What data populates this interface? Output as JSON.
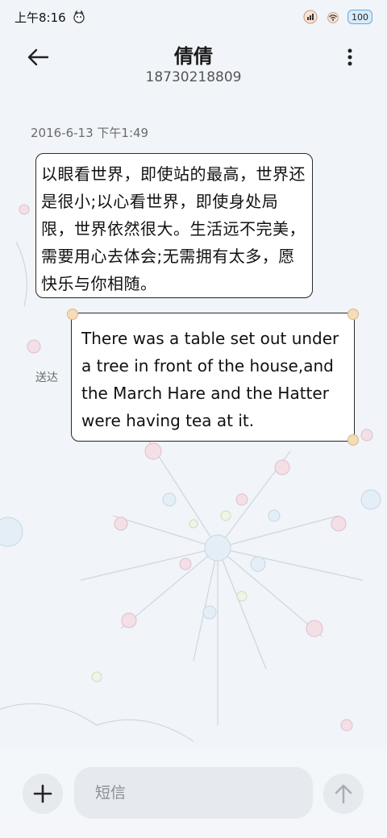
{
  "status_bar": {
    "time": "上午8:16",
    "left_icon": "pet-icon",
    "right_icons": [
      "signal-icon",
      "wifi-icon"
    ],
    "battery_level": "100"
  },
  "header": {
    "back_icon": "back-arrow-icon",
    "contact_name": "倩倩",
    "contact_number": "18730218809",
    "more_icon": "more-vertical-icon"
  },
  "conversation": {
    "timestamp": "2016-6-13 下午1:49",
    "messages": [
      {
        "direction": "sent",
        "text": "以眼看世界，即使站的最高，世界还是很小;以心看世界，即使身处局限，世界依然很大。生活远不完美，需要用心去体会;无需拥有太多，愿快乐与你相随。"
      },
      {
        "direction": "sent",
        "text": "There was a table set out under a tree in front of the house,and the March Hare and the Hatter were having tea at it.",
        "status": "送达"
      }
    ]
  },
  "composer": {
    "add_icon": "plus-icon",
    "placeholder": "短信",
    "send_icon": "arrow-up-icon"
  },
  "colors": {
    "background": "#f1f4f8",
    "bubble_border": "#2b2b2b",
    "bubble_fill": "#ffffff",
    "battery_accent": "#6aa7d8"
  }
}
